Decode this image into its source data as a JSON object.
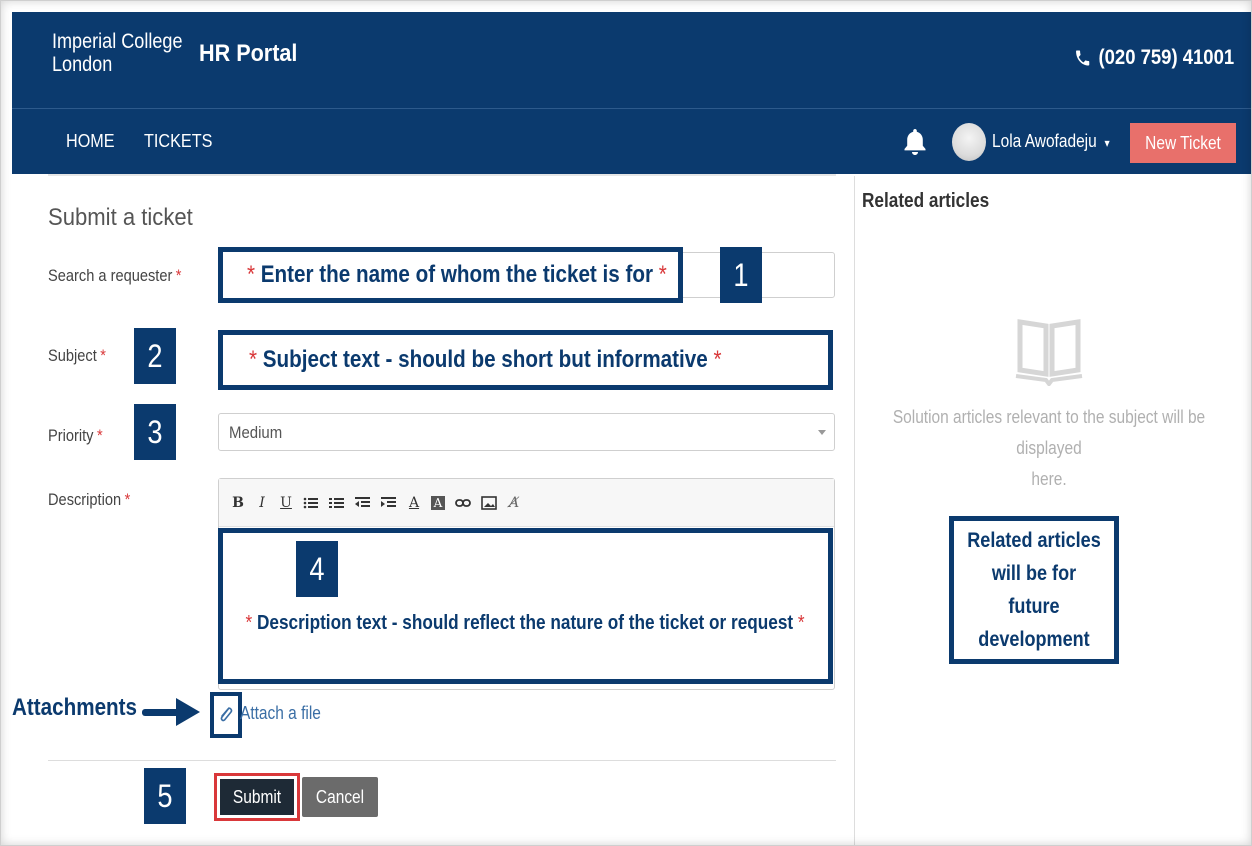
{
  "header": {
    "logo_line1": "Imperial College",
    "logo_line2": "London",
    "portal_title": "HR Portal",
    "phone": "(020 759) 41001"
  },
  "nav": {
    "home": "HOME",
    "tickets": "TICKETS",
    "user_name": "Lola Awofadeju",
    "new_ticket": "New Ticket"
  },
  "form": {
    "title": "Submit a ticket",
    "requester_label": "Search a requester",
    "subject_label": "Subject",
    "priority_label": "Priority",
    "description_label": "Description",
    "required_mark": "*",
    "priority_value": "Medium",
    "attach_link": "Attach a file",
    "submit": "Submit",
    "cancel": "Cancel"
  },
  "annotations": {
    "step1": "1",
    "step2": "2",
    "step3": "3",
    "step4": "4",
    "step5": "5",
    "requester_hint": "Enter the name of whom the ticket is for",
    "subject_hint": "Subject text -  should be short but informative",
    "description_hint": "Description text -  should reflect the nature of the ticket or request",
    "attachments": "Attachments",
    "future_line1": "Related articles",
    "future_line2": "will be for future",
    "future_line3": "development"
  },
  "sidebar": {
    "title": "Related articles",
    "empty_line1": "Solution articles relevant to the subject will be displayed",
    "empty_line2": "here."
  },
  "editor_toolbar": [
    "B",
    "I",
    "U",
    "bullet-list",
    "numbered-list",
    "outdent",
    "indent",
    "A",
    "A-bg",
    "link",
    "image",
    "clear-format"
  ],
  "colors": {
    "brand_navy": "#0b3a6e",
    "accent_red": "#d9383a",
    "new_ticket_bg": "#e8706b",
    "submit_bg": "#1e2a36",
    "cancel_bg": "#6b6b6b"
  }
}
